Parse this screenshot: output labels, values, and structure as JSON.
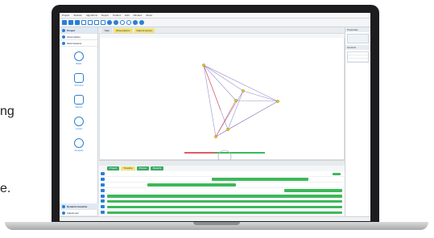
{
  "side_text": {
    "line1": "ng",
    "line2": "e."
  },
  "app": {
    "menu": [
      "Project",
      "Statistic",
      "Algorithms",
      "Report",
      "Toolbox",
      "Edit",
      "Window",
      "About"
    ],
    "toolbar_icons": [
      "save-icon",
      "open-icon",
      "new-icon",
      "undo-icon",
      "redo-icon",
      "pointer-icon",
      "move-icon",
      "zoom-in-icon",
      "zoom-out-icon",
      "search-icon",
      "refresh-icon",
      "info-icon",
      "help-icon"
    ]
  },
  "left_panel": {
    "project": "Project",
    "observables": "Observables",
    "multi_baseline": "Multi baseline",
    "tools": [
      {
        "label": "Basic",
        "icon": "globe-icon"
      },
      {
        "label": "Process",
        "icon": "network-icon"
      },
      {
        "label": "Report",
        "icon": "document-icon"
      },
      {
        "label": "Loops",
        "icon": "loop-icon"
      },
      {
        "label": "Analysis",
        "icon": "magnifier-icon"
      }
    ],
    "dynamic_baseline": "Dynamic baseline",
    "adjustment": "Adjustment"
  },
  "tabs": [
    "Map",
    "Observations",
    "Data Inventory"
  ],
  "right_panel": {
    "title": "Properties",
    "section": "General"
  },
  "timeline_tabs": [
    "Project",
    "Timeline",
    "Photos",
    "Reports"
  ],
  "timeline_rows": 11
}
